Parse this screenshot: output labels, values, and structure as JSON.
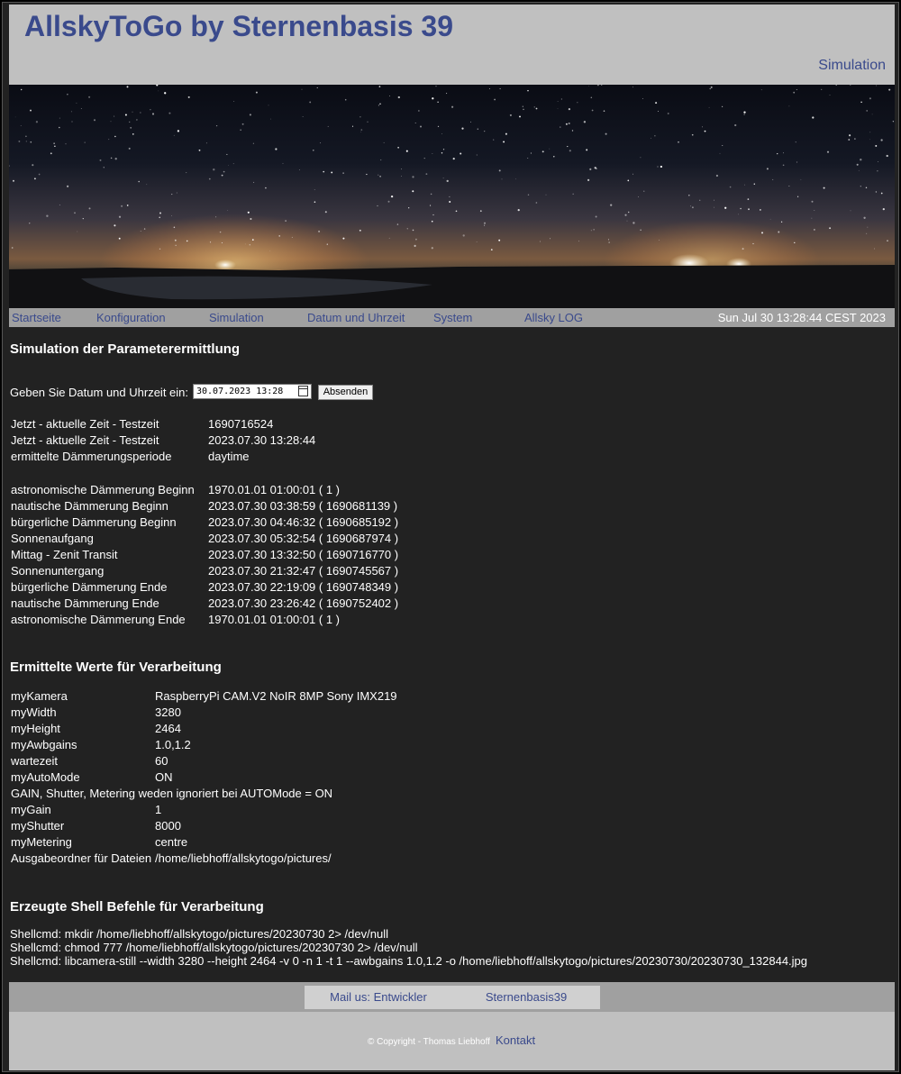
{
  "header": {
    "title": "AllskyToGo by Sternenbasis 39",
    "simulation_link": "Simulation"
  },
  "nav": {
    "items": [
      "Startseite",
      "Konfiguration",
      "Simulation",
      "Datum und Uhrzeit",
      "System",
      "Allsky LOG"
    ],
    "datetime": "Sun Jul 30 13:28:44 CEST 2023"
  },
  "sim": {
    "heading": "Simulation der Parameterermittlung",
    "input_label": "Geben Sie Datum und Uhrzeit ein:",
    "input_value": "30.07.2023 13:28",
    "submit_label": "Absenden",
    "rows_a": [
      [
        "Jetzt - aktuelle Zeit - Testzeit",
        "1690716524"
      ],
      [
        "Jetzt - aktuelle Zeit - Testzeit",
        "2023.07.30 13:28:44"
      ],
      [
        "ermittelte Dämmerungsperiode",
        "daytime"
      ]
    ],
    "rows_b": [
      [
        "astronomische Dämmerung Beginn",
        "1970.01.01 01:00:01 ( 1 )"
      ],
      [
        "nautische Dämmerung Beginn",
        "2023.07.30 03:38:59 ( 1690681139 )"
      ],
      [
        "bürgerliche Dämmerung Beginn",
        "2023.07.30 04:46:32 ( 1690685192 )"
      ],
      [
        "Sonnenaufgang",
        "2023.07.30 05:32:54 ( 1690687974 )"
      ],
      [
        "Mittag - Zenit Transit",
        "2023.07.30 13:32:50 ( 1690716770 )"
      ],
      [
        "Sonnenuntergang",
        "2023.07.30 21:32:47 ( 1690745567 )"
      ],
      [
        "bürgerliche Dämmerung Ende",
        "2023.07.30 22:19:09 ( 1690748349 )"
      ],
      [
        "nautische Dämmerung Ende",
        "2023.07.30 23:26:42 ( 1690752402 )"
      ],
      [
        "astronomische Dämmerung Ende",
        "1970.01.01 01:00:01 ( 1 )"
      ]
    ]
  },
  "values": {
    "heading": "Ermittelte Werte für Verarbeitung",
    "rows": [
      [
        "myKamera",
        "RaspberryPi CAM.V2 NoIR 8MP Sony IMX219"
      ],
      [
        "myWidth",
        "3280"
      ],
      [
        "myHeight",
        "2464"
      ],
      [
        "myAwbgains",
        "1.0,1.2"
      ],
      [
        "wartezeit",
        "60"
      ],
      [
        "myAutoMode",
        "ON"
      ],
      [
        "GAIN, Shutter, Metering weden ignoriert bei AUTOMode = ON",
        ""
      ],
      [
        "myGain",
        "1"
      ],
      [
        "myShutter",
        "8000"
      ],
      [
        "myMetering",
        "centre"
      ],
      [
        "Ausgabeordner für Dateien",
        "/home/liebhoff/allskytogo/pictures/"
      ]
    ]
  },
  "shell": {
    "heading": "Erzeugte Shell Befehle für Verarbeitung",
    "lines": [
      "Shellcmd: mkdir /home/liebhoff/allskytogo/pictures/20230730 2> /dev/null",
      "Shellcmd: chmod 777 /home/liebhoff/allskytogo/pictures/20230730 2> /dev/null",
      "Shellcmd: libcamera-still --width 3280 --height 2464 -v 0 -n 1 -t 1 --awbgains 1.0,1.2 -o /home/liebhoff/allskytogo/pictures/20230730/20230730_132844.jpg"
    ]
  },
  "footer": {
    "mail": "Mail us: Entwickler",
    "site": "Sternenbasis39",
    "copyright": "© Copyright - Thomas Liebhoff",
    "kontakt": "Kontakt"
  },
  "colors": {
    "link": "#3a4a8c",
    "page_bg": "#222222",
    "header_bg": "#c0c0c0",
    "nav_bg": "#a0a0a0"
  }
}
